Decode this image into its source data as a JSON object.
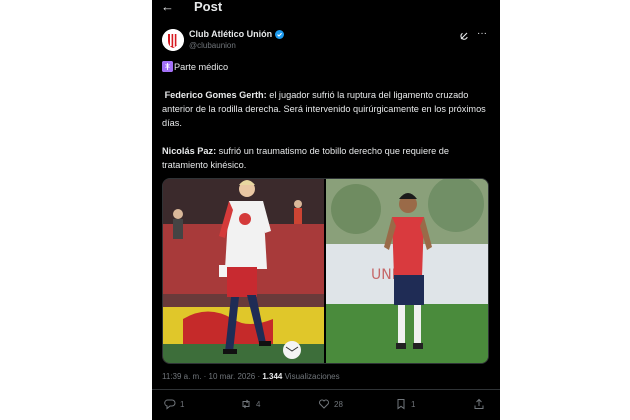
{
  "header": {
    "back_icon": "arrow-left-icon",
    "title": "Post"
  },
  "author": {
    "name": "Club Atlético Unión",
    "handle": "@clubaunion",
    "verified_color": "#1d9bf0"
  },
  "tweet": {
    "line1_text": "Parte médico",
    "p1_bold": "Federico Gomes Gerth:",
    "p1_text": " el jugador sufrió la ruptura del ligamento cruzado anterior de la rodilla derecha. Será intervenido quirúrgicamente en los próximos días.",
    "p2_bold": "Nicolás Paz:",
    "p2_text": " sufrió un traumatismo de tobillo derecho que requiere de tratamiento kinésico."
  },
  "meta": {
    "time": "11:39 a. m. · 10 mar. 2026 · ",
    "views": "1.344",
    "views_label": " Visualizaciones"
  },
  "actions": {
    "reply_count": "1",
    "repost_count": "4",
    "like_count": "28",
    "bookmark_count": "1"
  },
  "colors": {
    "background": "#000000",
    "text": "#e7e9ea",
    "muted": "#71767b",
    "accent": "#1d9bf0"
  }
}
